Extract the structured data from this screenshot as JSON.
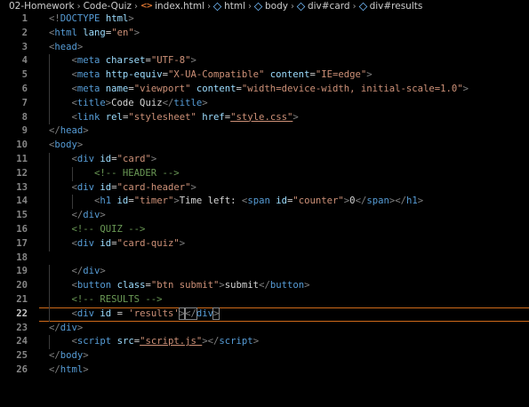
{
  "breadcrumb": {
    "items": [
      "02-Homework",
      "Code-Quiz",
      "index.html",
      "html",
      "body",
      "div#card",
      "div#results"
    ],
    "file_icon_text": "<>"
  },
  "editor": {
    "active_line": 22,
    "lines": [
      {
        "n": "1",
        "indent": 0,
        "tokens": [
          [
            "p",
            "<!"
          ],
          [
            "t",
            "DOCTYPE"
          ],
          [
            "x",
            " "
          ],
          [
            "a",
            "html"
          ],
          [
            "p",
            ">"
          ]
        ]
      },
      {
        "n": "2",
        "indent": 0,
        "tokens": [
          [
            "p",
            "<"
          ],
          [
            "t",
            "html"
          ],
          [
            "x",
            " "
          ],
          [
            "a",
            "lang"
          ],
          [
            "x",
            "="
          ],
          [
            "s",
            "\"en\""
          ],
          [
            "p",
            ">"
          ]
        ]
      },
      {
        "n": "3",
        "indent": 0,
        "tokens": [
          [
            "p",
            "<"
          ],
          [
            "t",
            "head"
          ],
          [
            "p",
            ">"
          ]
        ]
      },
      {
        "n": "4",
        "indent": 1,
        "tokens": [
          [
            "p",
            "<"
          ],
          [
            "t",
            "meta"
          ],
          [
            "x",
            " "
          ],
          [
            "a",
            "charset"
          ],
          [
            "x",
            "="
          ],
          [
            "s",
            "\"UTF-8\""
          ],
          [
            "p",
            ">"
          ]
        ]
      },
      {
        "n": "5",
        "indent": 1,
        "tokens": [
          [
            "p",
            "<"
          ],
          [
            "t",
            "meta"
          ],
          [
            "x",
            " "
          ],
          [
            "a",
            "http-equiv"
          ],
          [
            "x",
            "="
          ],
          [
            "s",
            "\"X-UA-Compatible\""
          ],
          [
            "x",
            " "
          ],
          [
            "a",
            "content"
          ],
          [
            "x",
            "="
          ],
          [
            "s",
            "\"IE=edge\""
          ],
          [
            "p",
            ">"
          ]
        ]
      },
      {
        "n": "6",
        "indent": 1,
        "tokens": [
          [
            "p",
            "<"
          ],
          [
            "t",
            "meta"
          ],
          [
            "x",
            " "
          ],
          [
            "a",
            "name"
          ],
          [
            "x",
            "="
          ],
          [
            "s",
            "\"viewport\""
          ],
          [
            "x",
            " "
          ],
          [
            "a",
            "content"
          ],
          [
            "x",
            "="
          ],
          [
            "s",
            "\"width=device-width, initial-scale=1.0\""
          ],
          [
            "p",
            ">"
          ]
        ]
      },
      {
        "n": "7",
        "indent": 1,
        "tokens": [
          [
            "p",
            "<"
          ],
          [
            "t",
            "title"
          ],
          [
            "p",
            ">"
          ],
          [
            "x",
            "Code Quiz"
          ],
          [
            "p",
            "</"
          ],
          [
            "t",
            "title"
          ],
          [
            "p",
            ">"
          ]
        ]
      },
      {
        "n": "8",
        "indent": 1,
        "tokens": [
          [
            "p",
            "<"
          ],
          [
            "t",
            "link"
          ],
          [
            "x",
            " "
          ],
          [
            "a",
            "rel"
          ],
          [
            "x",
            "="
          ],
          [
            "s",
            "\"stylesheet\""
          ],
          [
            "x",
            " "
          ],
          [
            "a",
            "href"
          ],
          [
            "x",
            "="
          ],
          [
            "su",
            "\"style.css\""
          ],
          [
            "p",
            ">"
          ]
        ]
      },
      {
        "n": "9",
        "indent": 0,
        "tokens": [
          [
            "p",
            "</"
          ],
          [
            "t",
            "head"
          ],
          [
            "p",
            ">"
          ]
        ]
      },
      {
        "n": "10",
        "indent": 0,
        "tokens": [
          [
            "p",
            "<"
          ],
          [
            "t",
            "body"
          ],
          [
            "p",
            ">"
          ]
        ]
      },
      {
        "n": "11",
        "indent": 1,
        "tokens": [
          [
            "p",
            "<"
          ],
          [
            "t",
            "div"
          ],
          [
            "x",
            " "
          ],
          [
            "a",
            "id"
          ],
          [
            "x",
            "="
          ],
          [
            "s",
            "\"card\""
          ],
          [
            "p",
            ">"
          ]
        ]
      },
      {
        "n": "12",
        "indent": 2,
        "tokens": [
          [
            "c",
            "<!-- HEADER -->"
          ]
        ]
      },
      {
        "n": "13",
        "indent": 1,
        "tokens": [
          [
            "p",
            "<"
          ],
          [
            "t",
            "div"
          ],
          [
            "x",
            " "
          ],
          [
            "a",
            "id"
          ],
          [
            "x",
            "="
          ],
          [
            "s",
            "\"card-header\""
          ],
          [
            "p",
            ">"
          ]
        ]
      },
      {
        "n": "14",
        "indent": 2,
        "tokens": [
          [
            "p",
            "<"
          ],
          [
            "t",
            "h1"
          ],
          [
            "x",
            " "
          ],
          [
            "a",
            "id"
          ],
          [
            "x",
            "="
          ],
          [
            "s",
            "\"timer\""
          ],
          [
            "p",
            ">"
          ],
          [
            "x",
            "Time left: "
          ],
          [
            "p",
            "<"
          ],
          [
            "t",
            "span"
          ],
          [
            "x",
            " "
          ],
          [
            "a",
            "id"
          ],
          [
            "x",
            "="
          ],
          [
            "s",
            "\"counter\""
          ],
          [
            "p",
            ">"
          ],
          [
            "x",
            "0"
          ],
          [
            "p",
            "</"
          ],
          [
            "t",
            "span"
          ],
          [
            "p",
            "></"
          ],
          [
            "t",
            "h1"
          ],
          [
            "p",
            ">"
          ]
        ]
      },
      {
        "n": "15",
        "indent": 1,
        "tokens": [
          [
            "p",
            "</"
          ],
          [
            "t",
            "div"
          ],
          [
            "p",
            ">"
          ]
        ]
      },
      {
        "n": "16",
        "indent": 1,
        "tokens": [
          [
            "c",
            "<!-- QUIZ -->"
          ]
        ]
      },
      {
        "n": "17",
        "indent": 1,
        "tokens": [
          [
            "p",
            "<"
          ],
          [
            "t",
            "div"
          ],
          [
            "x",
            " "
          ],
          [
            "a",
            "id"
          ],
          [
            "x",
            "="
          ],
          [
            "s",
            "\"card-quiz\""
          ],
          [
            "p",
            ">"
          ]
        ]
      },
      {
        "n": "18",
        "indent": 0,
        "tokens": []
      },
      {
        "n": "19",
        "indent": 1,
        "tokens": [
          [
            "p",
            "</"
          ],
          [
            "t",
            "div"
          ],
          [
            "p",
            ">"
          ]
        ]
      },
      {
        "n": "20",
        "indent": 1,
        "tokens": [
          [
            "p",
            "<"
          ],
          [
            "t",
            "button"
          ],
          [
            "x",
            " "
          ],
          [
            "a",
            "class"
          ],
          [
            "x",
            "="
          ],
          [
            "s",
            "\"btn submit\""
          ],
          [
            "p",
            ">"
          ],
          [
            "x",
            "submit"
          ],
          [
            "p",
            "</"
          ],
          [
            "t",
            "button"
          ],
          [
            "p",
            ">"
          ]
        ]
      },
      {
        "n": "21",
        "indent": 1,
        "tokens": [
          [
            "c",
            "<!-- RESULTS -->"
          ]
        ]
      },
      {
        "n": "22",
        "indent": 1,
        "tokens": [
          [
            "p",
            "<"
          ],
          [
            "t",
            "div"
          ],
          [
            "x",
            " "
          ],
          [
            "a",
            "id"
          ],
          [
            "x",
            " = "
          ],
          [
            "s",
            "'results'"
          ],
          [
            "pc",
            ">"
          ],
          [
            "pc",
            "</"
          ],
          [
            "t",
            "div"
          ],
          [
            "pc",
            ">"
          ]
        ]
      },
      {
        "n": "23",
        "indent": 0,
        "tokens": [
          [
            "p",
            "</"
          ],
          [
            "t",
            "div"
          ],
          [
            "p",
            ">"
          ]
        ]
      },
      {
        "n": "24",
        "indent": 1,
        "tokens": [
          [
            "p",
            "<"
          ],
          [
            "t",
            "script"
          ],
          [
            "x",
            " "
          ],
          [
            "a",
            "src"
          ],
          [
            "x",
            "="
          ],
          [
            "su",
            "\"script.js\""
          ],
          [
            "p",
            "></"
          ],
          [
            "t",
            "script"
          ],
          [
            "p",
            ">"
          ]
        ]
      },
      {
        "n": "25",
        "indent": 0,
        "tokens": [
          [
            "p",
            "</"
          ],
          [
            "t",
            "body"
          ],
          [
            "p",
            ">"
          ]
        ]
      },
      {
        "n": "26",
        "indent": 0,
        "tokens": [
          [
            "p",
            "</"
          ],
          [
            "t",
            "html"
          ],
          [
            "p",
            ">"
          ]
        ]
      }
    ]
  },
  "colors": {
    "background": "#000000",
    "tag": "#569cd6",
    "attribute": "#9cdcfe",
    "string": "#ce9178",
    "comment": "#6a9955",
    "punctuation": "#808080",
    "text": "#d4d4d4",
    "line_number": "#858585",
    "current_line_border": "#d06b1a"
  }
}
